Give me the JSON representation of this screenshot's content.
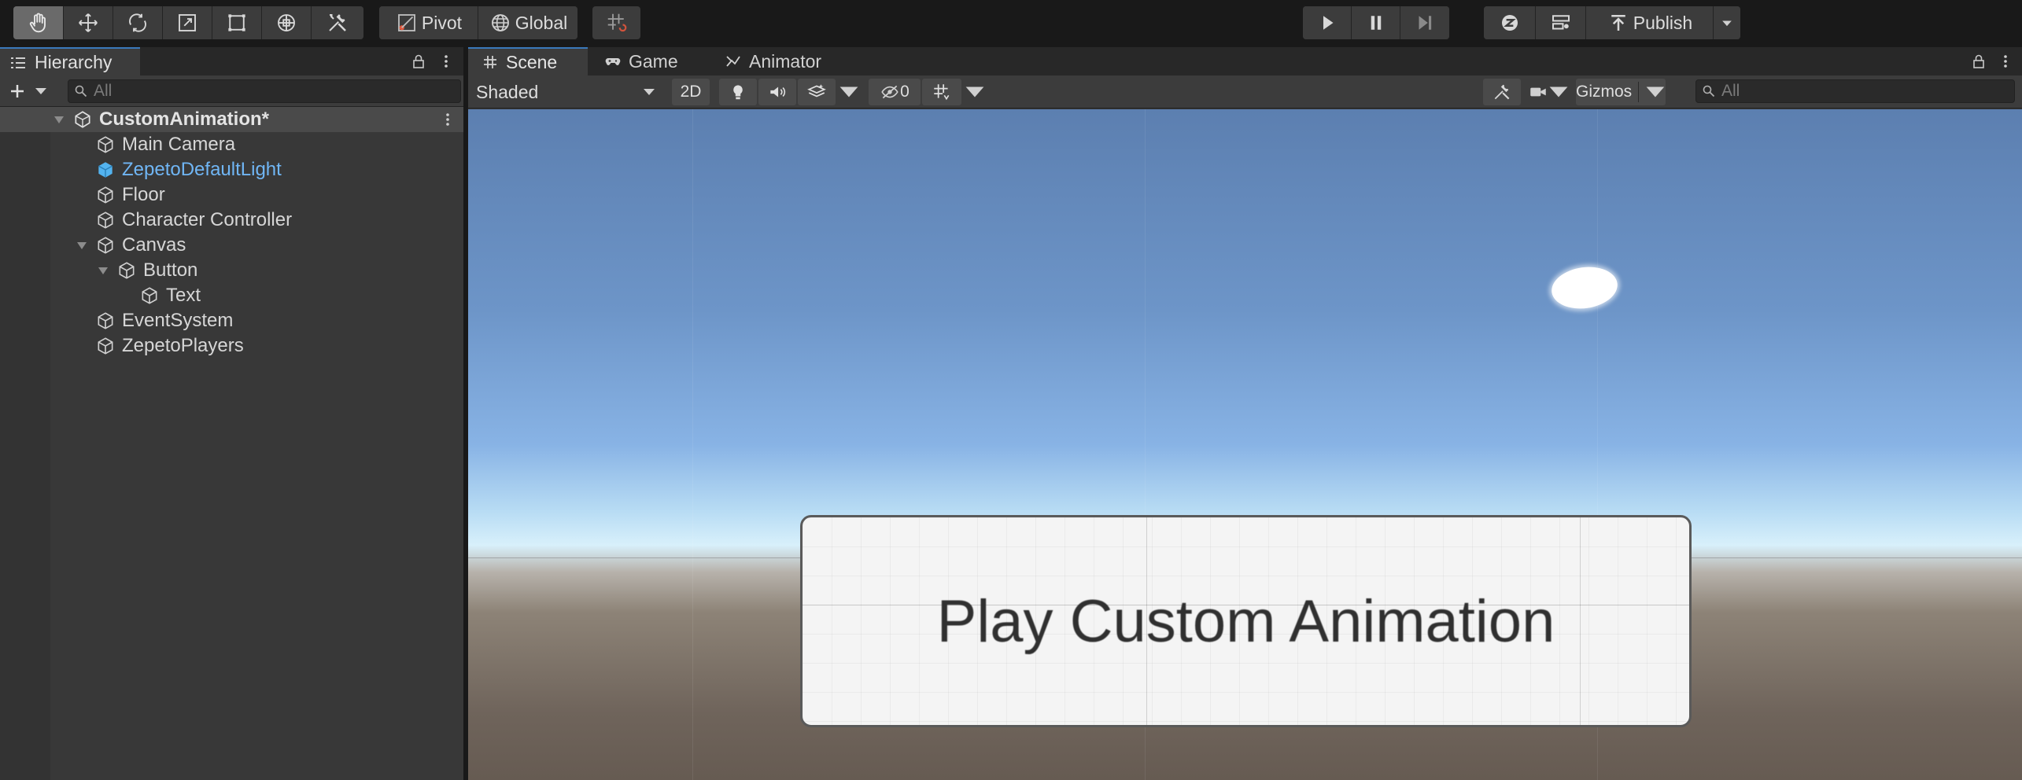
{
  "toolbar": {
    "tools": [
      "hand-tool",
      "move-tool",
      "rotate-tool",
      "scale-tool",
      "rect-tool",
      "transform-tool",
      "custom-editor-tool"
    ],
    "pivot_label": "Pivot",
    "global_label": "Global",
    "publish_label": "Publish"
  },
  "hierarchy": {
    "tab_label": "Hierarchy",
    "search_placeholder": "All",
    "scene_name": "CustomAnimation*",
    "items": [
      {
        "label": "Main Camera"
      },
      {
        "label": "ZepetoDefaultLight"
      },
      {
        "label": "Floor"
      },
      {
        "label": "Character Controller"
      },
      {
        "label": "Canvas"
      },
      {
        "label": "Button"
      },
      {
        "label": "Text"
      },
      {
        "label": "EventSystem"
      },
      {
        "label": "ZepetoPlayers"
      }
    ]
  },
  "scene": {
    "tabs": [
      {
        "label": "Scene"
      },
      {
        "label": "Game"
      },
      {
        "label": "Animator"
      }
    ],
    "shading_mode": "Shaded",
    "mode_2d_label": "2D",
    "hidden_count": "0",
    "gizmos_label": "Gizmos",
    "search_placeholder": "All",
    "ui_button_text": "Play Custom Animation"
  },
  "colors": {
    "accent": "#3a79bb",
    "selected_object": "#70b6f5",
    "background": "#191919",
    "panel": "#383838"
  }
}
